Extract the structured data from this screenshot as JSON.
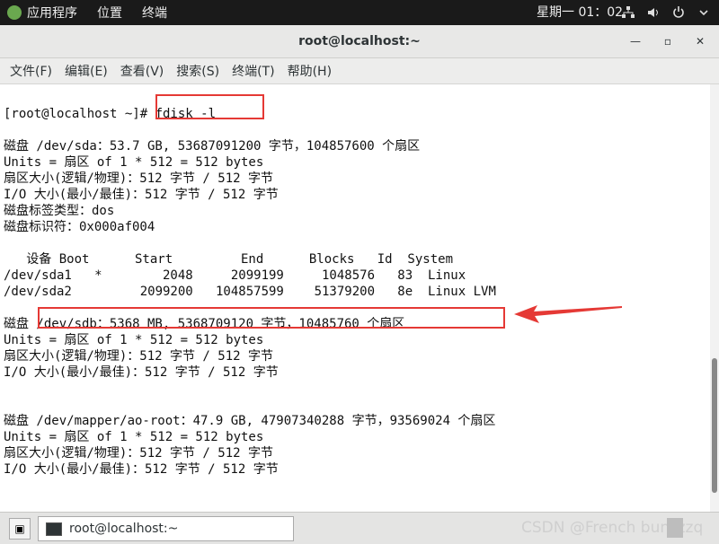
{
  "top_panel": {
    "apps_label": "应用程序",
    "places_label": "位置",
    "terminal_label": "终端",
    "clock": "星期一 01：02"
  },
  "window": {
    "title": "root@localhost:~",
    "minimize": "—",
    "maximize": "▫",
    "close": "✕"
  },
  "menu": [
    "文件(F)",
    "编辑(E)",
    "查看(V)",
    "搜索(S)",
    "终端(T)",
    "帮助(H)"
  ],
  "terminal_lines": [
    "[root@localhost ~]# fdisk -l",
    "",
    "磁盘 /dev/sda：53.7 GB, 53687091200 字节，104857600 个扇区",
    "Units = 扇区 of 1 * 512 = 512 bytes",
    "扇区大小(逻辑/物理)：512 字节 / 512 字节",
    "I/O 大小(最小/最佳)：512 字节 / 512 字节",
    "磁盘标签类型：dos",
    "磁盘标识符：0x000af004",
    "",
    "   设备 Boot      Start         End      Blocks   Id  System",
    "/dev/sda1   *        2048     2099199     1048576   83  Linux",
    "/dev/sda2         2099200   104857599    51379200   8e  Linux LVM",
    "",
    "磁盘 /dev/sdb：5368 MB, 5368709120 字节，10485760 个扇区",
    "Units = 扇区 of 1 * 512 = 512 bytes",
    "扇区大小(逻辑/物理)：512 字节 / 512 字节",
    "I/O 大小(最小/最佳)：512 字节 / 512 字节",
    "",
    "",
    "磁盘 /dev/mapper/ao-root：47.9 GB, 47907340288 字节，93569024 个扇区",
    "Units = 扇区 of 1 * 512 = 512 bytes",
    "扇区大小(逻辑/物理)：512 字节 / 512 字节",
    "I/O 大小(最小/最佳)：512 字节 / 512 字节"
  ],
  "taskbar": {
    "task_label": "root@localhost:~",
    "watermark": "CSDN @French bun_zzq"
  },
  "colors": {
    "annotation": "#e53935",
    "panel": "#1a1a1a"
  }
}
